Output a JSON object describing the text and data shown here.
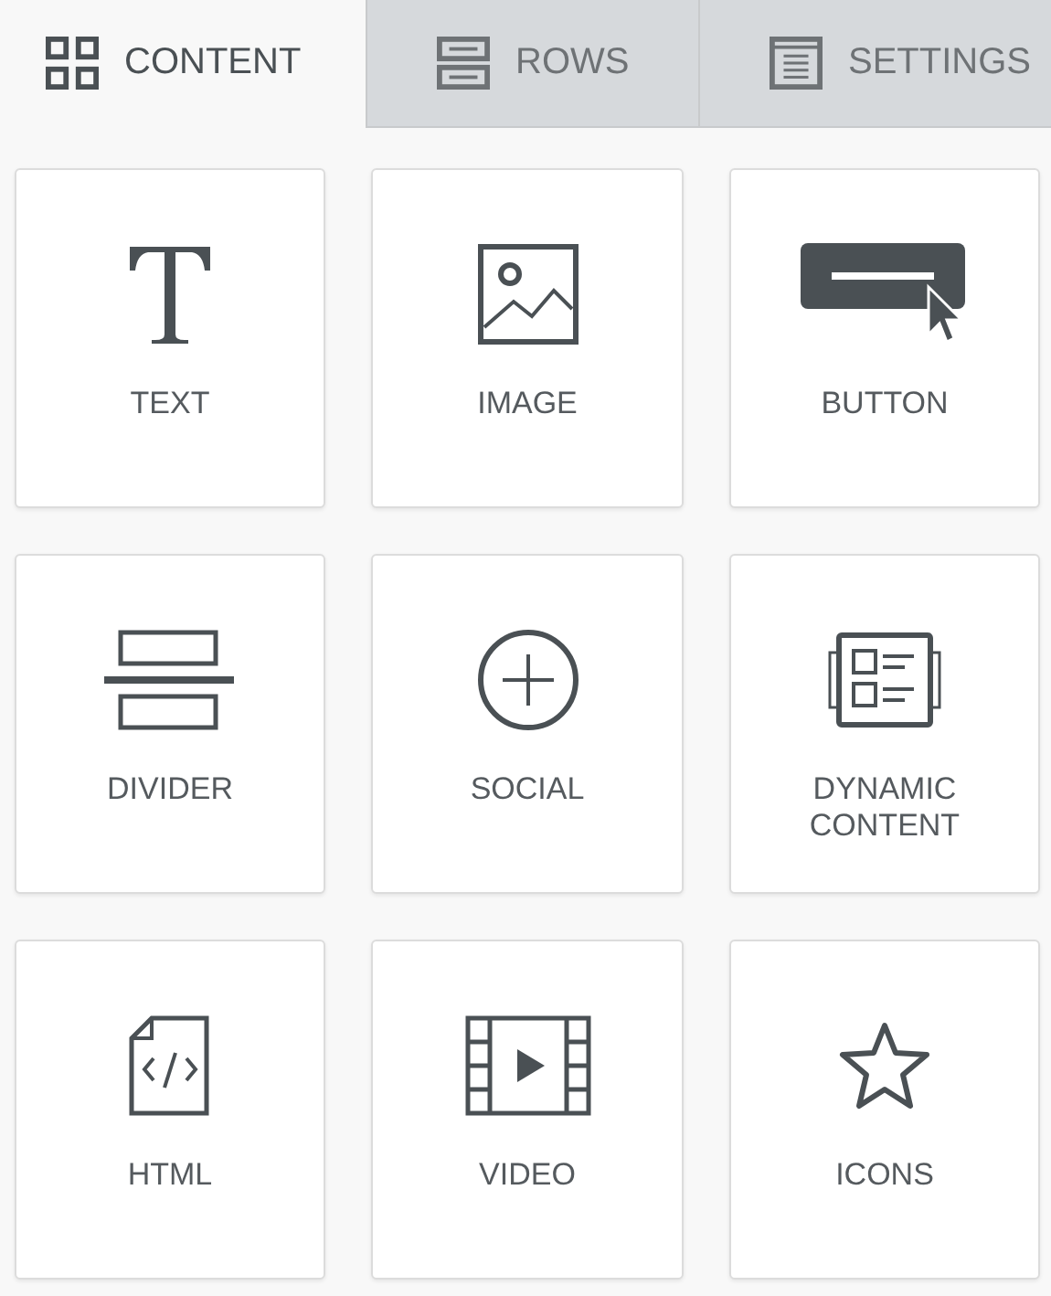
{
  "tabs": [
    {
      "label": "CONTENT",
      "kind": "content",
      "selected": true
    },
    {
      "label": "ROWS",
      "kind": "rows",
      "selected": false
    },
    {
      "label": "SETTINGS",
      "kind": "settings",
      "selected": false
    }
  ],
  "blocks": [
    {
      "label": "TEXT",
      "kind": "text"
    },
    {
      "label": "IMAGE",
      "kind": "image"
    },
    {
      "label": "BUTTON",
      "kind": "button"
    },
    {
      "label": "DIVIDER",
      "kind": "divider"
    },
    {
      "label": "SOCIAL",
      "kind": "social"
    },
    {
      "label": "DYNAMIC CONTENT",
      "kind": "dynamic"
    },
    {
      "label": "HTML",
      "kind": "html"
    },
    {
      "label": "VIDEO",
      "kind": "video"
    },
    {
      "label": "ICONS",
      "kind": "icons"
    }
  ]
}
